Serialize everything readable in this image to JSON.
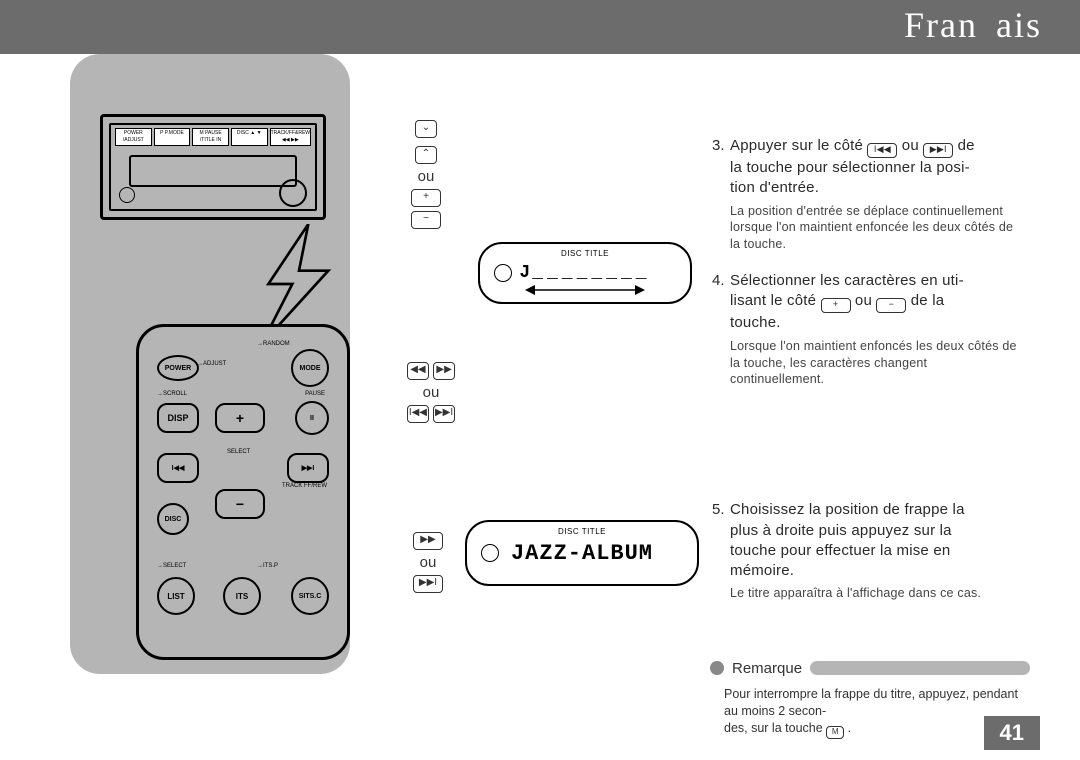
{
  "header": {
    "language": "Français",
    "language_part1": "Fran",
    "language_part2": "ais"
  },
  "page_number": "41",
  "head_unit": {
    "buttons": [
      "POWER /ADJUST",
      "P P.MODE",
      "M PAUSE /TITLE IN",
      "DISC ▲ ▼",
      "TRACK/FF&REW ◀◀ ▶▶"
    ]
  },
  "remote": {
    "top_labels": {
      "random": "→RANDOM",
      "adjust": "→ADJUST",
      "scroll": "→SCROLL",
      "pause": "PAUSE"
    },
    "btn_power": "POWER",
    "btn_mode": "MODE",
    "btn_disp": "DISP",
    "btn_plus": "+",
    "btn_pause": "II",
    "select_label": "SELECT",
    "btn_prev": "I◀◀",
    "btn_next": "▶▶I",
    "btn_minus": "−",
    "disc_label": "DISC",
    "track_label": "TRACK FF/REW",
    "its_p": "→ITS.P",
    "select_small": "→SELECT",
    "btn_list": "LIST",
    "btn_its": "ITS",
    "btn_itsc": "SITS.C"
  },
  "hints": {
    "group1": {
      "top_a": "⌄",
      "top_b": "⌃",
      "or": "ou",
      "plus": "+",
      "minus": "−"
    },
    "group2": {
      "prev": "◀◀",
      "next": "▶▶",
      "or": "ou",
      "pprev": "I◀◀",
      "pnext": "▶▶I"
    },
    "group3": {
      "next": "▶▶",
      "or": "ou",
      "pnext": "▶▶I"
    }
  },
  "displays": {
    "d1": {
      "label": "DISC TITLE",
      "text": "J _ _ _ _ _ _ _ _"
    },
    "d2": {
      "label": "DISC TITLE",
      "text": "JAZZ-ALBUM"
    }
  },
  "steps": {
    "s3": {
      "num": "3.",
      "line1a": "Appuyer sur le côté ",
      "btn1": "I◀◀",
      "mid": " ou ",
      "btn2": "▶▶I",
      "line1b": " de",
      "line2": "la touche pour sélectionner la posi-",
      "line3": "tion d'entrée.",
      "sub": "La position d'entrée se déplace conti­nuellement lorsque l'on maintient enfoncée les deux côtés de la touche."
    },
    "s4": {
      "num": "4.",
      "line1": "Sélectionner les caractères en uti-",
      "line2a": "lisant le côté ",
      "btn1": "+",
      "mid": " ou ",
      "btn2": "−",
      "line2b": " de la",
      "line3": "touche.",
      "sub": "Lorsque l'on maintient enfoncés les deux côtés de la touche, les caractères changent continuellement."
    },
    "s5": {
      "num": "5.",
      "line1": "Choisissez la position de frappe la",
      "line2": "plus à droite puis appuyez sur la",
      "line3": "touche pour effectuer la mise en",
      "line4": "mémoire.",
      "sub": "Le titre apparaîtra à l'affichage dans ce cas."
    }
  },
  "remarque": {
    "label": "Remarque",
    "text_a": "Pour interrompre la frappe du titre, appuyez, pendant au moins 2 secon-",
    "text_b": "des, sur la touche ",
    "btn": "M",
    "text_c": " ."
  }
}
